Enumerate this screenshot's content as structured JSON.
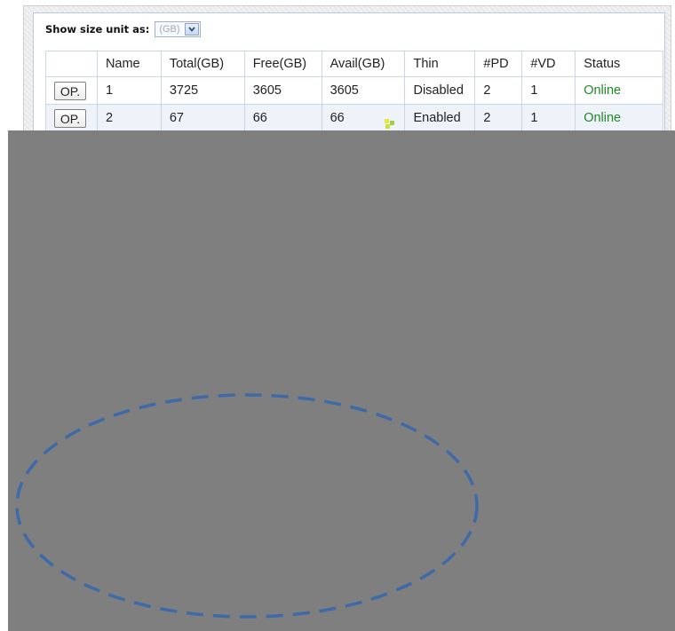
{
  "unit_selector": {
    "label": "Show size unit as:",
    "selected": "(GB)"
  },
  "table": {
    "headers": [
      "",
      "Name",
      "Total(GB)",
      "Free(GB)",
      "Avail(GB)",
      "Thin",
      "#PD",
      "#VD",
      "Status"
    ],
    "rows": [
      {
        "op_label": "OP.",
        "name": "1",
        "total": "3725",
        "free": "3605",
        "avail": "3605",
        "thin": "Disabled",
        "pd": "2",
        "vd": "1",
        "status": "Online"
      },
      {
        "op_label": "OP.",
        "name": "2",
        "total": "67",
        "free": "66",
        "avail": "66",
        "thin": "Enabled",
        "pd": "2",
        "vd": "1",
        "status": "Online"
      }
    ]
  },
  "colors": {
    "status_online": "#1f8a24",
    "overlay_gray": "#7f7f7f",
    "ellipse_stroke": "#3f6aa8",
    "table_border": "#cbd5e3"
  }
}
